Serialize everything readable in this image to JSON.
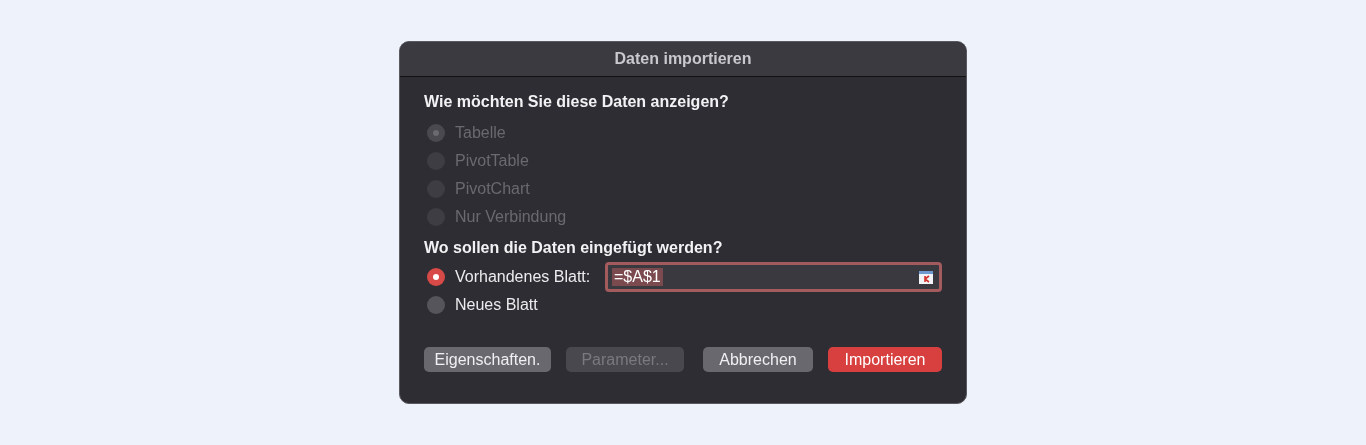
{
  "dialog": {
    "title": "Daten importieren",
    "view_section": {
      "heading": "Wie möchten Sie diese Daten anzeigen?",
      "options": [
        {
          "label": "Tabelle",
          "selected": true,
          "disabled": true
        },
        {
          "label": "PivotTable",
          "selected": false,
          "disabled": true
        },
        {
          "label": "PivotChart",
          "selected": false,
          "disabled": true
        },
        {
          "label": "Nur Verbindung",
          "selected": false,
          "disabled": true
        }
      ]
    },
    "target_section": {
      "heading": "Wo sollen die Daten eingefügt werden?",
      "options": [
        {
          "label": "Vorhandenes Blatt:",
          "selected": true,
          "disabled": false,
          "field": {
            "value": "=$A$1"
          }
        },
        {
          "label": "Neues Blatt",
          "selected": false,
          "disabled": false
        }
      ]
    },
    "buttons": [
      {
        "label": "Eigenschaften.",
        "disabled": false,
        "primary": false
      },
      {
        "label": "Parameter...",
        "disabled": true,
        "primary": false
      },
      {
        "label": "Abbrechen",
        "disabled": false,
        "primary": false
      },
      {
        "label": "Importieren",
        "disabled": false,
        "primary": true
      }
    ]
  }
}
